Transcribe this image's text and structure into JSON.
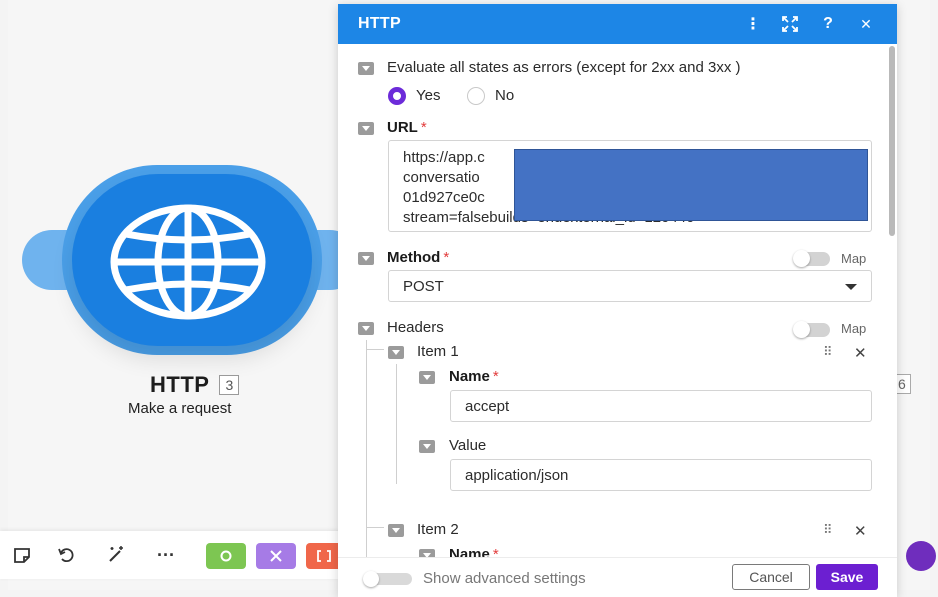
{
  "module": {
    "name": "HTTP",
    "badge": "3",
    "subtitle": "Make a request",
    "icon": "globe-icon",
    "accent_color": "#1a7fe0"
  },
  "canvas": {
    "next_module_badge": "6"
  },
  "toolbar": {
    "items": [
      {
        "icon": "note-icon",
        "glyph": "☐"
      },
      {
        "icon": "undo-icon",
        "glyph": "↶"
      },
      {
        "icon": "magic-wand-icon",
        "glyph": "✐"
      },
      {
        "icon": "more-icon",
        "glyph": "···"
      },
      {
        "icon": "settings-icon",
        "glyph": "⚙",
        "color": "#7dc652"
      },
      {
        "icon": "tools-icon",
        "glyph": "✕",
        "color": "#a67be6"
      },
      {
        "icon": "flow-control-icon",
        "glyph": "[ ]",
        "color": "#f0674a"
      }
    ]
  },
  "panel": {
    "title": "HTTP",
    "header_icons": {
      "more": "⋮",
      "expand": "⤢",
      "help": "?",
      "close": "✕"
    },
    "evaluate_errors": {
      "label": "Evaluate all states as errors (except for 2xx and 3xx )",
      "options": [
        "Yes",
        "No"
      ],
      "selected": "Yes"
    },
    "url": {
      "label": "URL",
      "required_mark": "*",
      "lines": [
        "https://app.c",
        "conversatio",
        "01d927ce0c",
        "stream=falsebuilds=endexternal_id=120440"
      ]
    },
    "method": {
      "label": "Method",
      "required_mark": "*",
      "map_label": "Map",
      "value": "POST"
    },
    "headers": {
      "label": "Headers",
      "map_label": "Map",
      "items": [
        {
          "title": "Item 1",
          "name_label": "Name",
          "name_value": "accept",
          "value_label": "Value",
          "value_value": "application/json"
        },
        {
          "title": "Item 2",
          "name_label": "Name"
        }
      ],
      "drag_glyph": "⠿",
      "remove_glyph": "✕"
    },
    "footer": {
      "advanced_label": "Show advanced settings",
      "cancel_label": "Cancel",
      "save_label": "Save"
    }
  }
}
